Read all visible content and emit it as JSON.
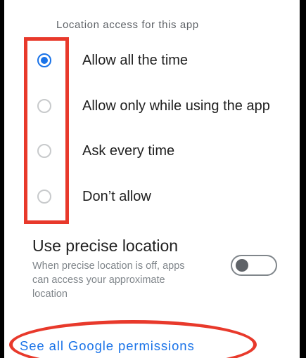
{
  "section_header": "Location access for this app",
  "options": [
    {
      "label": "Allow all the time",
      "selected": true
    },
    {
      "label": "Allow only while using the app",
      "selected": false
    },
    {
      "label": "Ask every time",
      "selected": false
    },
    {
      "label": "Don’t allow",
      "selected": false
    }
  ],
  "precise_location": {
    "title": "Use precise location",
    "description": "When precise location is off, apps can access your approximate location",
    "enabled": false
  },
  "link_label": "See all Google permissions",
  "colors": {
    "accent": "#1a73e8",
    "annotation": "#e8392b"
  }
}
